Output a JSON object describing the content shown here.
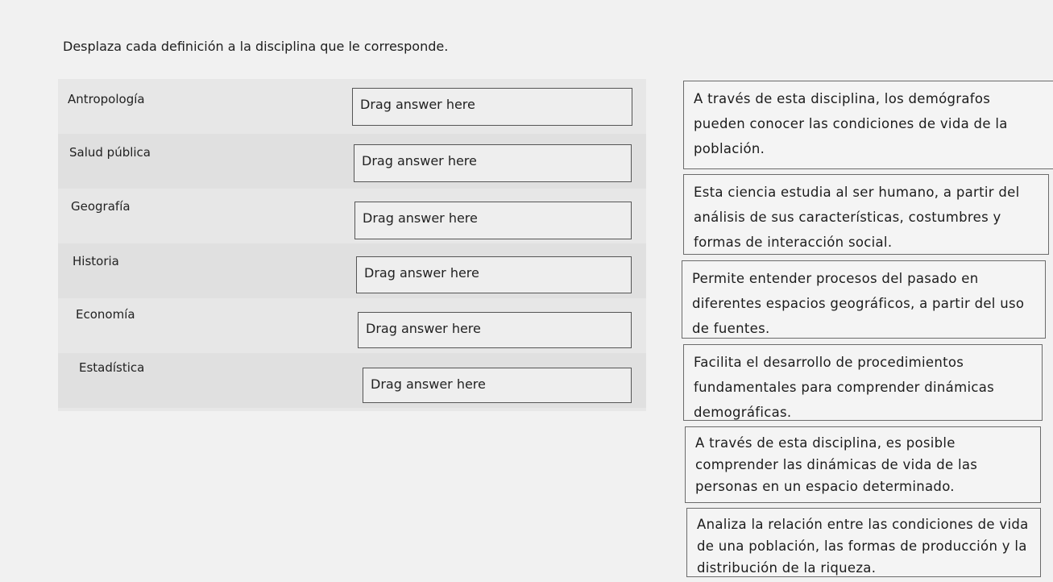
{
  "instruction": "Desplaza cada definición a la disciplina que le corresponde.",
  "drop_placeholder": "Drag answer here",
  "terms": [
    {
      "label": "Antropología"
    },
    {
      "label": "Salud pública"
    },
    {
      "label": "Geografía"
    },
    {
      "label": "Historia"
    },
    {
      "label": "Economía"
    },
    {
      "label": "Estadística"
    }
  ],
  "definitions": [
    {
      "text": "A través de esta disciplina, los demógrafos pueden conocer las condiciones de vida de la población."
    },
    {
      "text": "Esta ciencia estudia al ser humano, a partir del análisis de sus características, costumbres y formas de interacción social."
    },
    {
      "text": "Permite entender procesos del pasado en diferentes espacios geográficos, a partir del uso de fuentes."
    },
    {
      "text": "Facilita el desarrollo de procedimientos fundamentales para comprender dinámicas demográficas."
    },
    {
      "text": "A través de esta disciplina, es posible comprender las dinámicas de vida de las personas en un espacio determinado."
    },
    {
      "text": "Analiza la relación entre las condiciones de vida de una población, las formas de producción y la distribución de la riqueza."
    }
  ]
}
